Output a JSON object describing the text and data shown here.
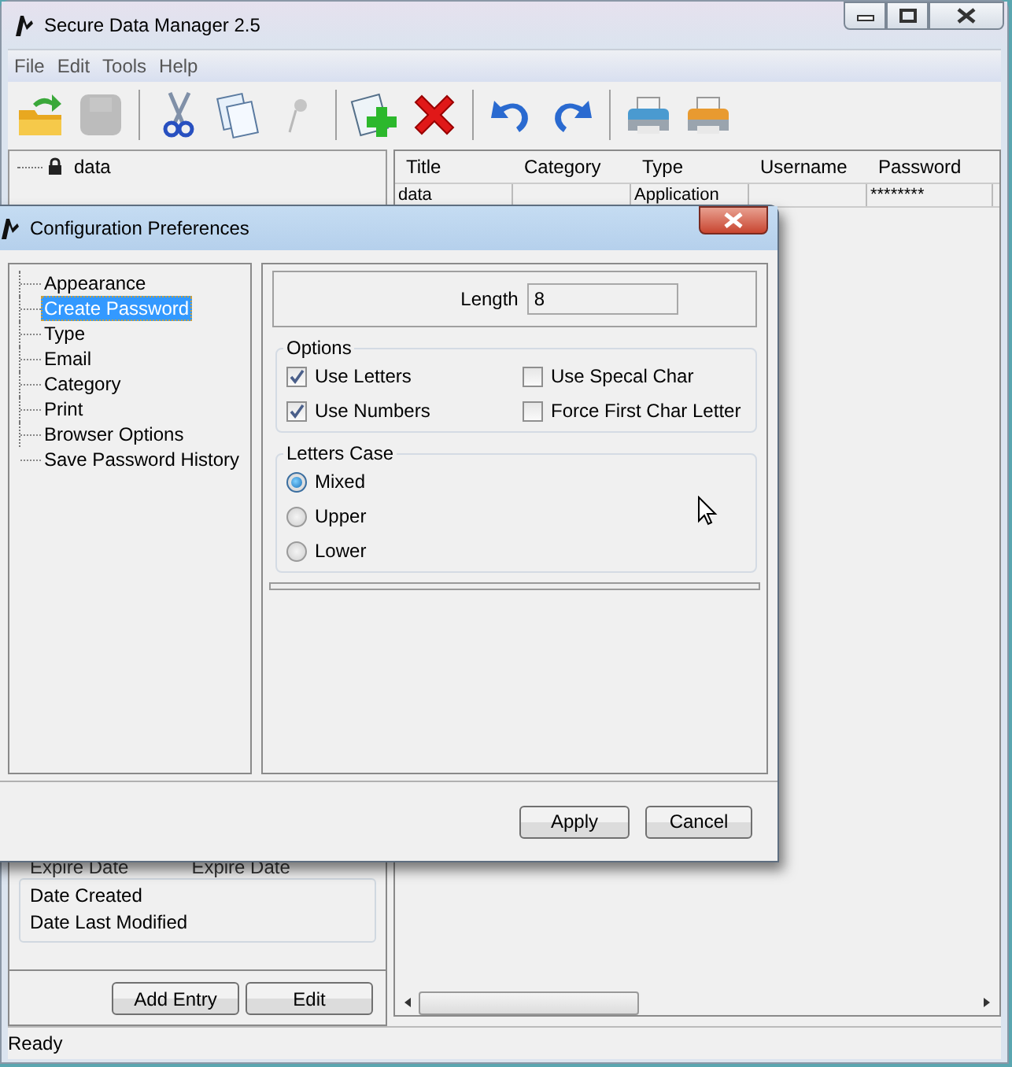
{
  "window": {
    "title": "Secure Data Manager 2.5"
  },
  "menu": [
    "File",
    "Edit",
    "Tools",
    "Help"
  ],
  "toolbar": [
    {
      "items": [
        {
          "kind": "open",
          "disabled": false
        },
        {
          "kind": "save",
          "disabled": true
        }
      ]
    },
    {
      "items": [
        {
          "kind": "cut",
          "disabled": false
        },
        {
          "kind": "copy",
          "disabled": false
        },
        {
          "kind": "paste",
          "disabled": true
        }
      ]
    },
    {
      "items": [
        {
          "kind": "add",
          "disabled": false
        },
        {
          "kind": "delete",
          "disabled": false
        }
      ]
    },
    {
      "items": [
        {
          "kind": "undo",
          "disabled": false
        },
        {
          "kind": "redo",
          "disabled": false
        }
      ]
    },
    {
      "items": [
        {
          "kind": "print",
          "disabled": false
        },
        {
          "kind": "print_preview",
          "disabled": false
        }
      ]
    }
  ],
  "tree": {
    "items": [
      {
        "label": "data"
      }
    ]
  },
  "table": {
    "columns": [
      "Title",
      "Category",
      "Type",
      "Username",
      "Password"
    ],
    "rows": [
      {
        "title": "data",
        "type": "Application",
        "password": "********"
      }
    ]
  },
  "details": {
    "expire_labels": [
      "Expire Date",
      "Expire Date"
    ],
    "dates": [
      "Date Created",
      "Date Last Modified"
    ],
    "buttons": [
      "Add Entry",
      "Edit"
    ]
  },
  "status_bar": "Ready",
  "dialog": {
    "title": "Configuration Preferences",
    "nav": [
      {
        "label": "Appearance",
        "selected": false
      },
      {
        "label": "Create Password",
        "selected": true
      },
      {
        "label": "Type",
        "selected": false
      },
      {
        "label": "Email",
        "selected": false
      },
      {
        "label": "Category",
        "selected": false
      },
      {
        "label": "Print",
        "selected": false
      },
      {
        "label": "Browser Options",
        "selected": false
      },
      {
        "label": "Save Password History",
        "selected": false
      }
    ],
    "length": {
      "label": "Length",
      "value": "8"
    },
    "options": {
      "title": "Options",
      "items": [
        {
          "label": "Use Letters",
          "checked": true
        },
        {
          "label": "Use Specal Char",
          "checked": false
        },
        {
          "label": "Use Numbers",
          "checked": true
        },
        {
          "label": "Force First Char Letter",
          "checked": false
        }
      ]
    },
    "letters_case": {
      "title": "Letters Case",
      "choices": [
        {
          "label": "Mixed",
          "selected": true
        },
        {
          "label": "Upper",
          "selected": false
        },
        {
          "label": "Lower",
          "selected": false
        }
      ]
    },
    "buttons": [
      "Apply",
      "Cancel"
    ]
  }
}
